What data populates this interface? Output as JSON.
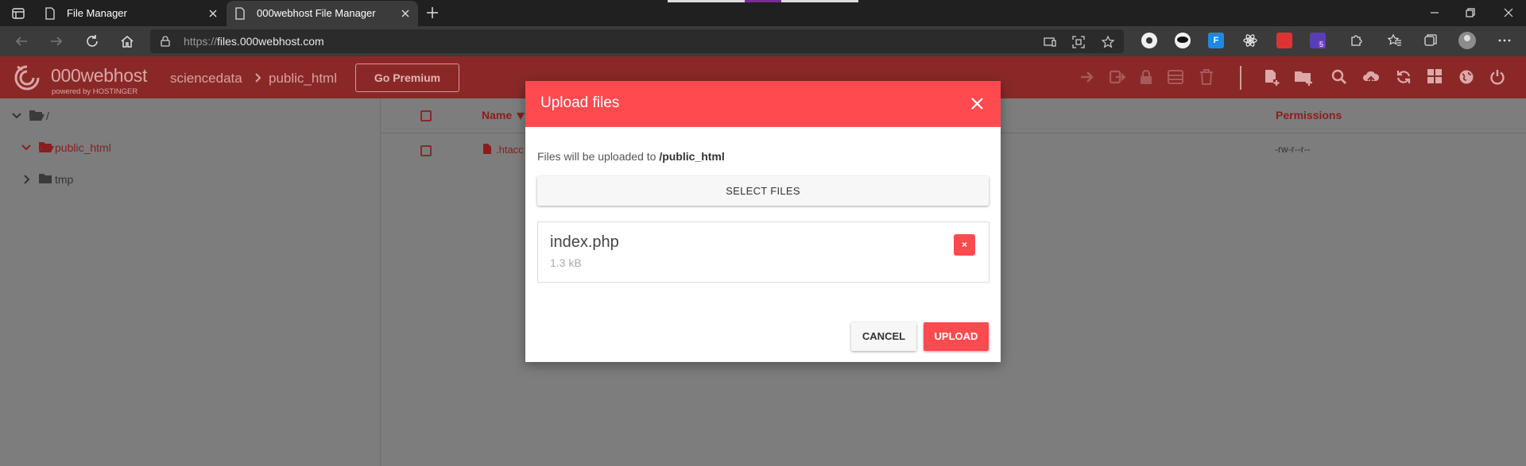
{
  "browser": {
    "tabs": [
      {
        "title": "File Manager"
      },
      {
        "title": "000webhost File Manager"
      }
    ],
    "url_prefix": "https://",
    "url_host": "files.000webhost.com",
    "extension_badge": "5"
  },
  "app": {
    "brand_name": "000webhost",
    "brand_sub": "powered by HOSTINGER",
    "breadcrumb": [
      "sciencedata",
      "public_html"
    ],
    "premium_label": "Go Premium"
  },
  "tree": {
    "root": "/",
    "items": [
      {
        "label": "public_html"
      },
      {
        "label": "tmp"
      }
    ]
  },
  "table": {
    "columns": {
      "name": "Name",
      "permissions": "Permissions"
    },
    "rows": [
      {
        "name": ".htacc",
        "permissions": "-rw-r--r--"
      }
    ]
  },
  "modal": {
    "title": "Upload files",
    "dest_prefix": "Files will be uploaded to ",
    "dest_path": "/public_html",
    "select_label": "SELECT FILES",
    "file": {
      "name": "index.php",
      "size": "1.3 kB"
    },
    "remove_label": "×",
    "cancel_label": "CANCEL",
    "upload_label": "UPLOAD"
  },
  "colors": {
    "accent": "#ff4b4f",
    "header_dim": "#8a2828",
    "overlay": "#7d7d7d"
  }
}
